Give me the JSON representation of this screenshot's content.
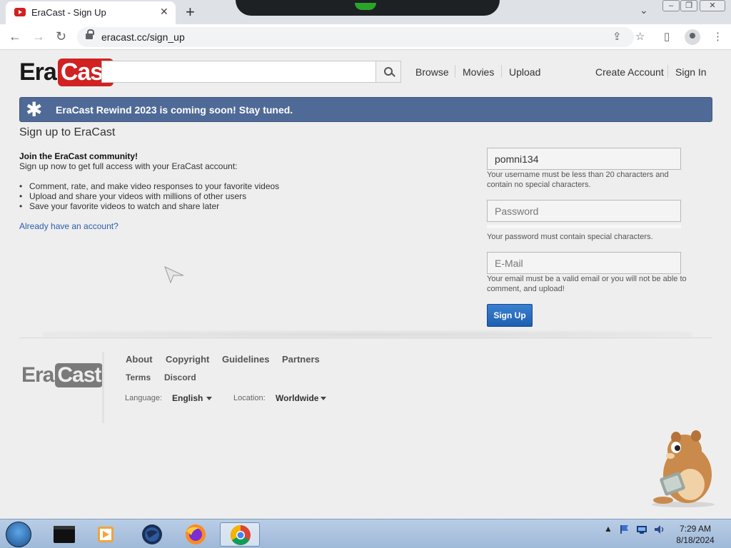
{
  "browser": {
    "tab_title": "EraCast - Sign Up",
    "tab_close": "✕",
    "new_tab": "+",
    "tab_list": "⌄",
    "url": "eracast.cc/sign_up",
    "back": "←",
    "forward": "→",
    "reload": "↻",
    "share": "⇪",
    "bookmark": "☆",
    "sidepanel": "▯",
    "menu": "⋮",
    "window_buttons": [
      "–",
      "❐",
      "✕"
    ]
  },
  "site": {
    "logo_part1": "Era",
    "logo_part2": "Cast",
    "search_value": "",
    "nav": {
      "browse": "Browse",
      "movies": "Movies",
      "upload": "Upload",
      "create_account": "Create Account",
      "sign_in": "Sign In"
    },
    "banner_icon": "✱",
    "banner_text": "EraCast Rewind 2023 is coming soon! Stay tuned."
  },
  "signup": {
    "title": "Sign up to EraCast",
    "join_heading": "Join the EraCast community!",
    "join_sub": "Sign up now to get full access with your EraCast account:",
    "benefits": [
      "Comment, rate, and make video responses to your favorite videos",
      "Upload and share your videos with millions of other users",
      "Save your favorite videos to watch and share later"
    ],
    "already_link": "Already have an account?",
    "username_value": "pomni134",
    "username_hint": "Your username must be less than 20 characters and contain no special characters.",
    "password_placeholder": "Password",
    "password_hint": "Your password must contain special characters.",
    "email_placeholder": "E-Mail",
    "email_hint": "Your email must be a valid email or you will not be able to comment, and upload!",
    "submit": "Sign Up"
  },
  "footer": {
    "logo_part1": "Era",
    "logo_part2": "Cast",
    "links": [
      "About",
      "Copyright",
      "Guidelines",
      "Partners"
    ],
    "links2": [
      "Terms",
      "Discord"
    ],
    "language_label": "Language:",
    "language_value": "English",
    "location_label": "Location:",
    "location_value": "Worldwide"
  },
  "taskbar": {
    "tray_arrow": "▲",
    "time": "7:29 AM",
    "date": "8/18/2024"
  }
}
